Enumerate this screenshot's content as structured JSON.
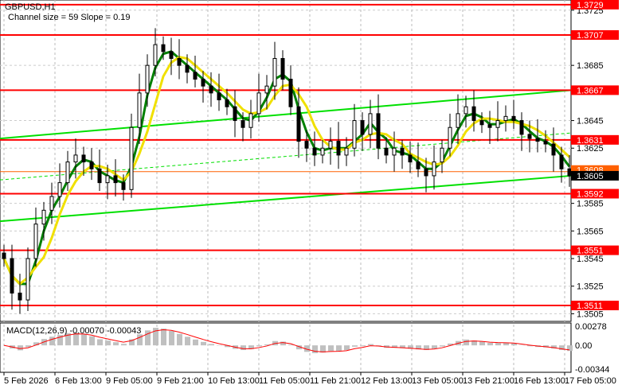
{
  "header": {
    "symbol": "GBPUSD,H1",
    "channel_info": "Channel size = 59 Slope = 0.19"
  },
  "macd": {
    "label": "MACD(12,26,9) -0.00070 -0.00043",
    "axis": [
      "0.00278",
      "0.00",
      "-0.00344"
    ],
    "max": 0.00278,
    "min": -0.00344
  },
  "colors": {
    "level": "#ff0000",
    "channel": "#00e000",
    "ma_fast": "#008000",
    "ma_slow": "#f0e000",
    "current": "#000000",
    "macd_signal": "#ff0000",
    "macd_hist": "#c0c0c0"
  },
  "chart_data": {
    "type": "candlestick",
    "title": "GBPUSD,H1",
    "ylim": [
      1.35,
      1.3732
    ],
    "price_ticks": [
      "1.3725",
      "1.3685",
      "1.3645",
      "1.3625",
      "1.3585",
      "1.3565",
      "1.3545",
      "1.3525",
      "1.3505"
    ],
    "levels": [
      {
        "value": 1.3729,
        "label": "1.3729"
      },
      {
        "value": 1.3707,
        "label": "1.3707"
      },
      {
        "value": 1.3667,
        "label": "1.3667"
      },
      {
        "value": 1.3631,
        "label": "1.3631"
      },
      {
        "value": 1.3592,
        "label": "1.3592"
      },
      {
        "value": 1.3551,
        "label": "1.3551"
      },
      {
        "value": 1.3511,
        "label": "1.3511"
      }
    ],
    "current_price": {
      "value": 1.3605,
      "label": "1.3605"
    },
    "ask_line": {
      "value": 1.3608,
      "label": "1.3608"
    },
    "channel": {
      "upper": [
        1.3632,
        1.3667
      ],
      "lower": [
        1.3572,
        1.3605
      ]
    },
    "x_labels": [
      "5 Feb 2026",
      "6 Feb 13:00",
      "9 Feb 05:00",
      "9 Feb 21:00",
      "10 Feb 13:00",
      "11 Feb 05:00",
      "11 Feb 21:00",
      "12 Feb 13:00",
      "13 Feb 05:00",
      "13 Feb 21:00",
      "16 Feb 13:00",
      "17 Feb 05:00"
    ],
    "closes": [
      1.3545,
      1.352,
      1.3515,
      1.3545,
      1.357,
      1.358,
      1.359,
      1.36,
      1.3615,
      1.362,
      1.3615,
      1.361,
      1.36,
      1.3605,
      1.36,
      1.3595,
      1.364,
      1.3665,
      1.3685,
      1.37,
      1.3695,
      1.369,
      1.3685,
      1.368,
      1.3675,
      1.367,
      1.3665,
      1.366,
      1.3655,
      1.3645,
      1.364,
      1.365,
      1.3665,
      1.367,
      1.369,
      1.3675,
      1.3655,
      1.363,
      1.3625,
      1.362,
      1.3625,
      1.363,
      1.362,
      1.3625,
      1.3645,
      1.3635,
      1.365,
      1.3625,
      1.362,
      1.3625,
      1.362,
      1.3615,
      1.361,
      1.3605,
      1.3615,
      1.3625,
      1.364,
      1.365,
      1.3655,
      1.3645,
      1.3642,
      1.364,
      1.3645,
      1.3648,
      1.3645,
      1.3635,
      1.3632,
      1.363,
      1.3628,
      1.362,
      1.361,
      1.3605
    ]
  }
}
